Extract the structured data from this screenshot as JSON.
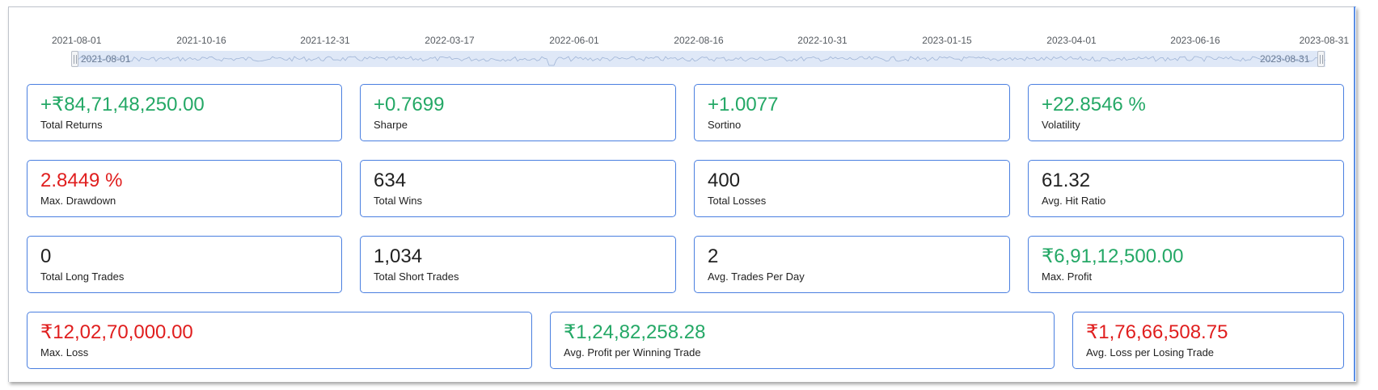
{
  "timeline": {
    "ticks": [
      "2021-08-01",
      "2021-10-16",
      "2021-12-31",
      "2022-03-17",
      "2022-06-01",
      "2022-08-16",
      "2022-10-31",
      "2023-01-15",
      "2023-04-01",
      "2023-06-16",
      "2023-08-31"
    ],
    "range_start": "2021-08-01",
    "range_end": "2023-08-31"
  },
  "stats": [
    {
      "value": "+₹84,71,48,250.00",
      "label": "Total Returns",
      "tone": "positive"
    },
    {
      "value": "+0.7699",
      "label": "Sharpe",
      "tone": "positive"
    },
    {
      "value": "+1.0077",
      "label": "Sortino",
      "tone": "positive"
    },
    {
      "value": "+22.8546 %",
      "label": "Volatility",
      "tone": "positive"
    },
    {
      "value": "2.8449 %",
      "label": "Max. Drawdown",
      "tone": "negative"
    },
    {
      "value": "634",
      "label": "Total Wins",
      "tone": "neutral"
    },
    {
      "value": "400",
      "label": "Total Losses",
      "tone": "neutral"
    },
    {
      "value": "61.32",
      "label": "Avg. Hit Ratio",
      "tone": "neutral"
    },
    {
      "value": "0",
      "label": "Total Long Trades",
      "tone": "neutral"
    },
    {
      "value": "1,034",
      "label": "Total Short Trades",
      "tone": "neutral"
    },
    {
      "value": "2",
      "label": "Avg. Trades Per Day",
      "tone": "neutral"
    },
    {
      "value": "₹6,91,12,500.00",
      "label": "Max. Profit",
      "tone": "positive"
    },
    {
      "value": "₹12,02,70,000.00",
      "label": "Max. Loss",
      "tone": "negative"
    },
    {
      "value": "₹1,24,82,258.28",
      "label": "Avg. Profit per Winning Trade",
      "tone": "positive"
    },
    {
      "value": "₹1,76,66,508.75",
      "label": "Avg. Loss per Losing Trade",
      "tone": "negative"
    }
  ],
  "colors": {
    "positive": "#24a866",
    "negative": "#e01e1e",
    "neutral": "#212121",
    "card_border": "#4a7fe0",
    "slider_fill": "#dfe8f7"
  }
}
